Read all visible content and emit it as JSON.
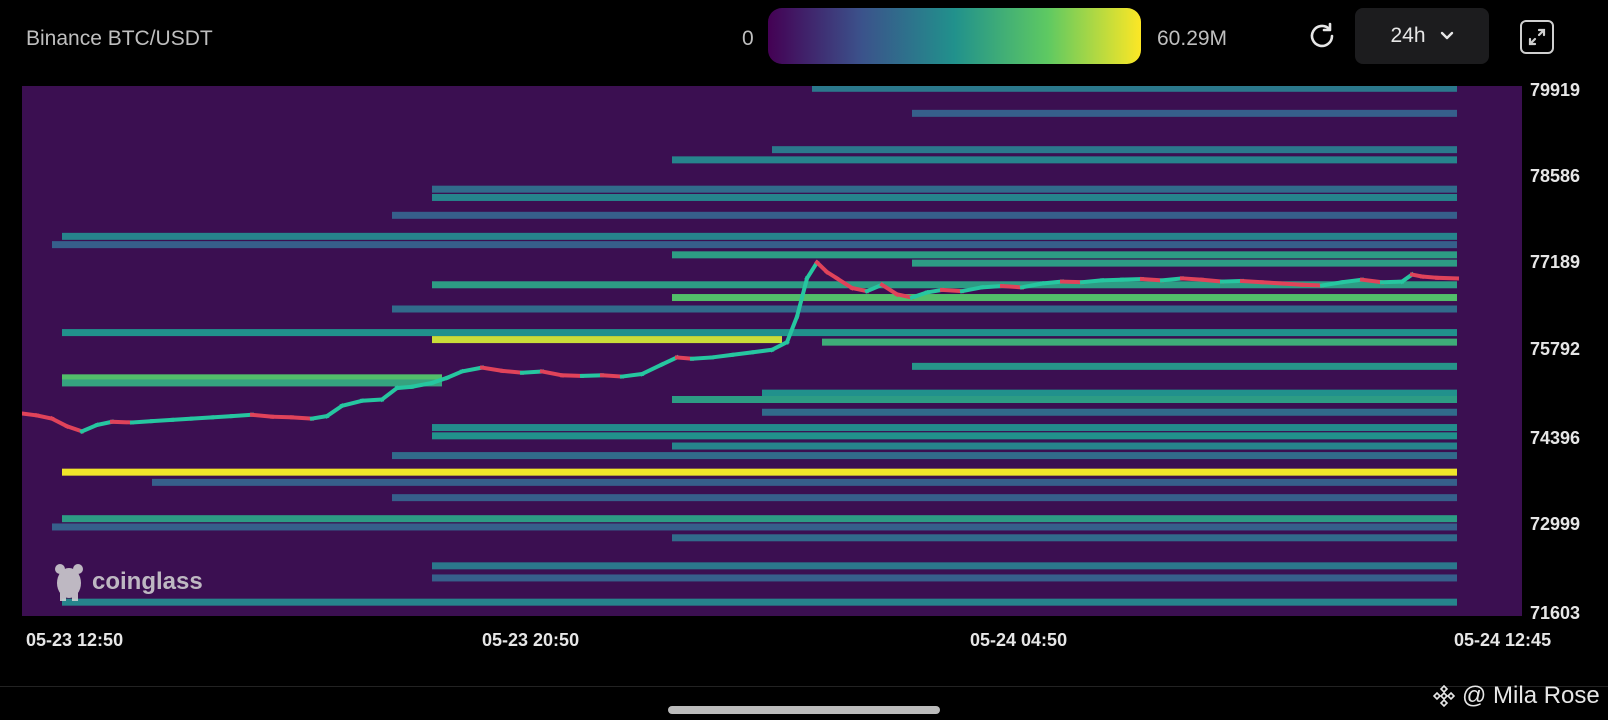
{
  "header": {
    "title": "Binance BTC/USDT",
    "colorbar_min": "0",
    "colorbar_max": "60.29M",
    "timeframe": "24h",
    "icons": {
      "refresh": "refresh-icon",
      "dropdown": "chevron-down-icon",
      "expand": "expand-icon"
    }
  },
  "watermark": {
    "text": "coinglass",
    "icon": "coinglass-logo-icon"
  },
  "footer": {
    "credit": "@ Mila Rose",
    "icon": "binance-logo-icon"
  },
  "colors": {
    "background": "#3b0f51",
    "up": "#26c6a0",
    "down": "#e0435a",
    "scale": [
      "#440154",
      "#3b528b",
      "#21918c",
      "#5ec962",
      "#fde725"
    ]
  },
  "chart_data": {
    "type": "heatmap",
    "title": "Binance BTC/USDT",
    "x_range": [
      "05-23 12:50",
      "05-24 12:45"
    ],
    "xticks": [
      {
        "label": "05-23 12:50",
        "t": 0
      },
      {
        "label": "05-23 20:50",
        "t": 480
      },
      {
        "label": "05-24 04:50",
        "t": 960
      },
      {
        "label": "05-24 12:45",
        "t": 1435
      }
    ],
    "ylim": [
      71603,
      79919
    ],
    "yticks": [
      "79919",
      "78586",
      "77189",
      "75792",
      "74396",
      "72999",
      "71603"
    ],
    "colorbar": {
      "min": "0",
      "max": "60.29M"
    },
    "liquidity_bands": [
      {
        "price": 79883,
        "start": 790,
        "end": 1435,
        "level": 0.4
      },
      {
        "price": 79490,
        "start": 890,
        "end": 1435,
        "level": 0.3
      },
      {
        "price": 78920,
        "start": 750,
        "end": 1435,
        "level": 0.4
      },
      {
        "price": 78760,
        "start": 650,
        "end": 1435,
        "level": 0.45
      },
      {
        "price": 78300,
        "start": 410,
        "end": 1435,
        "level": 0.35
      },
      {
        "price": 78170,
        "start": 410,
        "end": 1435,
        "level": 0.45
      },
      {
        "price": 77890,
        "start": 370,
        "end": 1435,
        "level": 0.3
      },
      {
        "price": 77560,
        "start": 40,
        "end": 1435,
        "level": 0.45
      },
      {
        "price": 77430,
        "start": 30,
        "end": 1435,
        "level": 0.3
      },
      {
        "price": 77270,
        "start": 650,
        "end": 1435,
        "level": 0.55
      },
      {
        "price": 77140,
        "start": 890,
        "end": 1435,
        "level": 0.55
      },
      {
        "price": 76800,
        "start": 410,
        "end": 1435,
        "level": 0.55
      },
      {
        "price": 76600,
        "start": 650,
        "end": 1435,
        "level": 0.7
      },
      {
        "price": 76420,
        "start": 370,
        "end": 1435,
        "level": 0.35
      },
      {
        "price": 76050,
        "start": 40,
        "end": 1435,
        "level": 0.5
      },
      {
        "price": 75940,
        "start": 410,
        "end": 760,
        "level": 0.92
      },
      {
        "price": 75900,
        "start": 800,
        "end": 1435,
        "level": 0.62
      },
      {
        "price": 75520,
        "start": 890,
        "end": 1435,
        "level": 0.52
      },
      {
        "price": 75340,
        "start": 40,
        "end": 420,
        "level": 0.7
      },
      {
        "price": 75260,
        "start": 40,
        "end": 420,
        "level": 0.58
      },
      {
        "price": 75100,
        "start": 740,
        "end": 1435,
        "level": 0.5
      },
      {
        "price": 75000,
        "start": 650,
        "end": 1435,
        "level": 0.55
      },
      {
        "price": 74800,
        "start": 740,
        "end": 1435,
        "level": 0.35
      },
      {
        "price": 74560,
        "start": 410,
        "end": 1435,
        "level": 0.48
      },
      {
        "price": 74430,
        "start": 410,
        "end": 1435,
        "level": 0.5
      },
      {
        "price": 74270,
        "start": 650,
        "end": 1435,
        "level": 0.45
      },
      {
        "price": 74120,
        "start": 370,
        "end": 1435,
        "level": 0.35
      },
      {
        "price": 73860,
        "start": 40,
        "end": 1435,
        "level": 0.98
      },
      {
        "price": 73700,
        "start": 130,
        "end": 1435,
        "level": 0.3
      },
      {
        "price": 73460,
        "start": 370,
        "end": 1435,
        "level": 0.3
      },
      {
        "price": 73130,
        "start": 40,
        "end": 1435,
        "level": 0.55
      },
      {
        "price": 73000,
        "start": 30,
        "end": 1435,
        "level": 0.3
      },
      {
        "price": 72830,
        "start": 650,
        "end": 1435,
        "level": 0.35
      },
      {
        "price": 72390,
        "start": 410,
        "end": 1435,
        "level": 0.4
      },
      {
        "price": 72200,
        "start": 410,
        "end": 1435,
        "level": 0.3
      },
      {
        "price": 71820,
        "start": 40,
        "end": 1435,
        "level": 0.45
      }
    ],
    "price_series": [
      [
        0,
        74780
      ],
      [
        15,
        74750
      ],
      [
        30,
        74700
      ],
      [
        45,
        74580
      ],
      [
        60,
        74500
      ],
      [
        75,
        74600
      ],
      [
        90,
        74650
      ],
      [
        110,
        74640
      ],
      [
        130,
        74660
      ],
      [
        150,
        74680
      ],
      [
        170,
        74700
      ],
      [
        190,
        74720
      ],
      [
        210,
        74740
      ],
      [
        230,
        74760
      ],
      [
        250,
        74730
      ],
      [
        270,
        74720
      ],
      [
        290,
        74700
      ],
      [
        305,
        74740
      ],
      [
        320,
        74900
      ],
      [
        340,
        74980
      ],
      [
        360,
        75000
      ],
      [
        375,
        75180
      ],
      [
        390,
        75200
      ],
      [
        410,
        75260
      ],
      [
        425,
        75340
      ],
      [
        440,
        75440
      ],
      [
        460,
        75500
      ],
      [
        480,
        75450
      ],
      [
        500,
        75420
      ],
      [
        520,
        75440
      ],
      [
        540,
        75380
      ],
      [
        560,
        75370
      ],
      [
        580,
        75380
      ],
      [
        600,
        75360
      ],
      [
        620,
        75400
      ],
      [
        640,
        75550
      ],
      [
        655,
        75660
      ],
      [
        670,
        75640
      ],
      [
        690,
        75660
      ],
      [
        710,
        75700
      ],
      [
        730,
        75740
      ],
      [
        750,
        75780
      ],
      [
        765,
        75900
      ],
      [
        775,
        76300
      ],
      [
        785,
        76900
      ],
      [
        795,
        77150
      ],
      [
        805,
        77000
      ],
      [
        815,
        76900
      ],
      [
        830,
        76750
      ],
      [
        845,
        76700
      ],
      [
        860,
        76800
      ],
      [
        875,
        76650
      ],
      [
        890,
        76600
      ],
      [
        905,
        76680
      ],
      [
        920,
        76720
      ],
      [
        940,
        76700
      ],
      [
        960,
        76760
      ],
      [
        980,
        76780
      ],
      [
        1000,
        76760
      ],
      [
        1020,
        76820
      ],
      [
        1040,
        76850
      ],
      [
        1060,
        76840
      ],
      [
        1080,
        76870
      ],
      [
        1100,
        76880
      ],
      [
        1120,
        76890
      ],
      [
        1140,
        76870
      ],
      [
        1160,
        76900
      ],
      [
        1180,
        76880
      ],
      [
        1200,
        76850
      ],
      [
        1220,
        76860
      ],
      [
        1240,
        76840
      ],
      [
        1260,
        76820
      ],
      [
        1280,
        76800
      ],
      [
        1300,
        76790
      ],
      [
        1320,
        76840
      ],
      [
        1340,
        76880
      ],
      [
        1360,
        76840
      ],
      [
        1380,
        76850
      ],
      [
        1390,
        76960
      ],
      [
        1400,
        76930
      ],
      [
        1415,
        76910
      ],
      [
        1435,
        76900
      ]
    ]
  }
}
